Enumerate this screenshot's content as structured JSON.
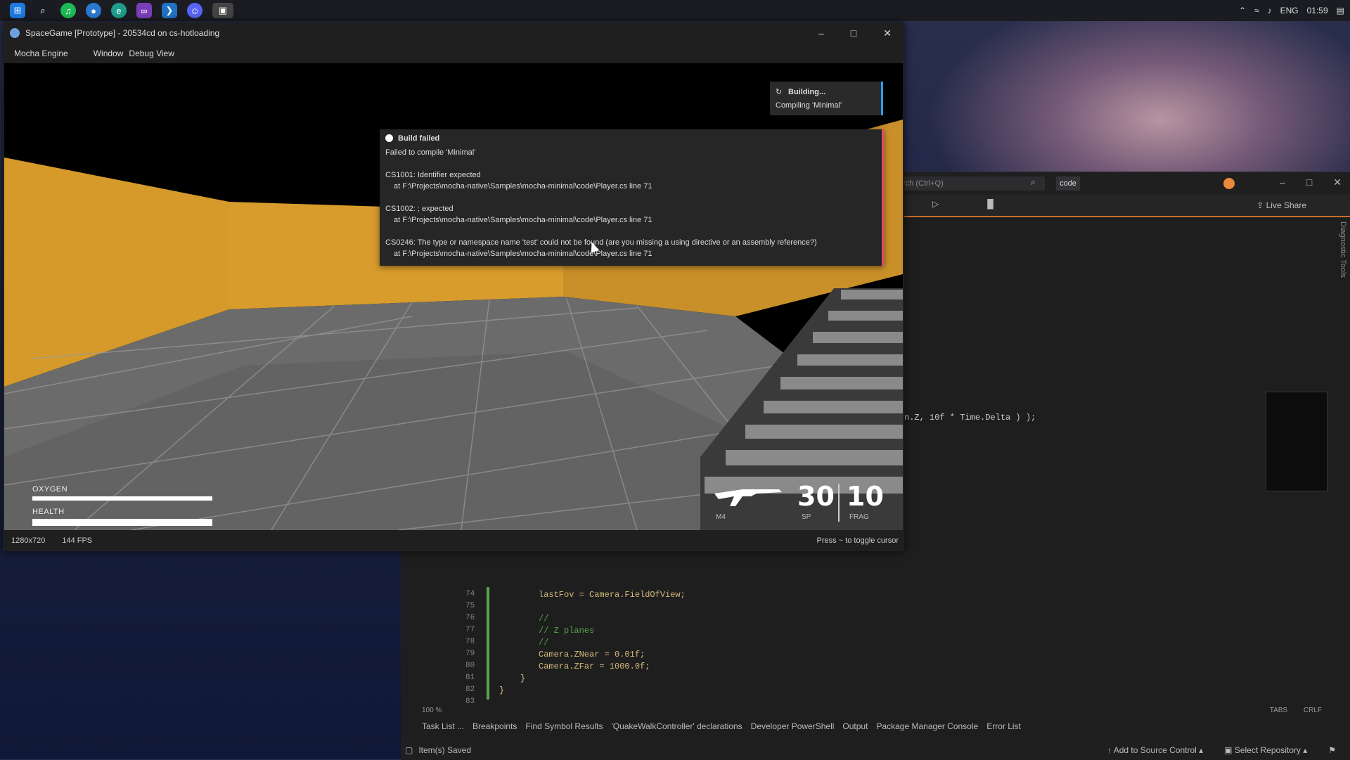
{
  "taskbar": {
    "icons": [
      "windows-icon",
      "search-icon",
      "spotify-icon",
      "app-icon",
      "edge-icon",
      "visual-studio-icon",
      "vscode-icon",
      "discord-icon",
      "active-app-icon"
    ],
    "tray": {
      "language": "ENG",
      "time": "01:59"
    }
  },
  "game_window": {
    "title": "SpaceGame [Prototype] - 20534cd on cs-hotloading",
    "menu": [
      "Mocha Engine",
      "Window",
      "Debug View"
    ],
    "status_resolution": "1280x720",
    "status_fps": "144 FPS",
    "status_hint": "Press ~ to toggle cursor",
    "hud": {
      "oxygen_label": "OXYGEN",
      "health_label": "HEALTH",
      "oxygen_level": 1.0,
      "health_level": 1.0,
      "weapon_label": "M4",
      "ammo": "30",
      "ammo_label": "SP",
      "frag": "10",
      "frag_label": "FRAG"
    },
    "building_toast": {
      "title": "Building...",
      "detail": "Compiling 'Minimal'"
    },
    "error_panel": {
      "title": "Build failed",
      "subtitle": "Failed to compile 'Minimal'",
      "errors": [
        {
          "message": "CS1001: Identifier expected",
          "location": "at F:\\Projects\\mocha-native\\Samples\\mocha-minimal\\code\\Player.cs line 71"
        },
        {
          "message": "CS1002: ; expected",
          "location": "at F:\\Projects\\mocha-native\\Samples\\mocha-minimal\\code\\Player.cs line 71"
        },
        {
          "message": "CS0246: The type or namespace name 'test' could not be found (are you missing a using directive or an assembly reference?)",
          "location": "at F:\\Projects\\mocha-native\\Samples\\mocha-minimal\\code\\Player.cs line 71"
        }
      ]
    }
  },
  "vs_window": {
    "search_placeholder": "rch (Ctrl+Q)",
    "solution_name": "code",
    "live_share": "Live Share",
    "side_label": "Diagnostic Tools",
    "code_fragment": "n.Z, 10f * Time.Delta ) );",
    "code_lines": [
      {
        "num": "74",
        "text": "lastFov = Camera.FieldOfView;"
      },
      {
        "num": "75",
        "text": ""
      },
      {
        "num": "76",
        "text": "//"
      },
      {
        "num": "77",
        "text": "// Z planes"
      },
      {
        "num": "78",
        "text": "//"
      },
      {
        "num": "79",
        "text": "Camera.ZNear = 0.01f;"
      },
      {
        "num": "80",
        "text": "Camera.ZFar = 1000.0f;"
      },
      {
        "num": "81",
        "text": "}"
      },
      {
        "num": "82",
        "text": "}"
      },
      {
        "num": "83",
        "text": ""
      }
    ],
    "zoom": "100 %",
    "tabs_label": "TABS",
    "eol_label": "CRLF",
    "bottom_tabs": [
      "Task List ...",
      "Breakpoints",
      "Find Symbol Results",
      "'QuakeWalkController' declarations",
      "Developer PowerShell",
      "Output",
      "Package Manager Console",
      "Error List"
    ],
    "status_saved": "Item(s) Saved",
    "add_to_source": "Add to Source Control",
    "select_repo": "Select Repository"
  },
  "colors": {
    "accent_blue": "#2f9cff",
    "error_red": "#e04a6a",
    "vs_orange": "#c86d2d",
    "wall_orange": "#d89a2c"
  }
}
